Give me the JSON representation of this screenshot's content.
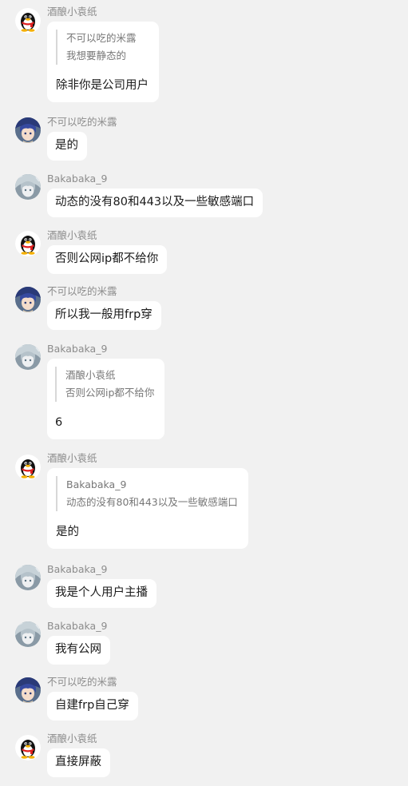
{
  "messages": [
    {
      "sender": "酒酿小袁纸",
      "avatar": "qq-penguin-icon",
      "quote": {
        "sender": "不可以吃的米露",
        "text": "我想要静态的"
      },
      "text": "除非你是公司用户"
    },
    {
      "sender": "不可以吃的米露",
      "avatar": "blue-hair-avatar-icon",
      "text": "是的"
    },
    {
      "sender": "Bakabaka_9",
      "avatar": "silver-hair-avatar-icon",
      "text": "动态的没有80和443以及一些敏感端口"
    },
    {
      "sender": "酒酿小袁纸",
      "avatar": "qq-penguin-icon",
      "text": "否则公网ip都不给你"
    },
    {
      "sender": "不可以吃的米露",
      "avatar": "blue-hair-avatar-icon",
      "text": "所以我一般用frp穿"
    },
    {
      "sender": "Bakabaka_9",
      "avatar": "silver-hair-avatar-icon",
      "quote": {
        "sender": "酒酿小袁纸",
        "text": "否则公网ip都不给你"
      },
      "text": "6"
    },
    {
      "sender": "酒酿小袁纸",
      "avatar": "qq-penguin-icon",
      "quote": {
        "sender": "Bakabaka_9",
        "text": "动态的没有80和443以及一些敏感端口"
      },
      "text": "是的"
    },
    {
      "sender": "Bakabaka_9",
      "avatar": "silver-hair-avatar-icon",
      "text": "我是个人用户主播"
    },
    {
      "sender": "Bakabaka_9",
      "avatar": "silver-hair-avatar-icon",
      "text": "我有公网"
    },
    {
      "sender": "不可以吃的米露",
      "avatar": "blue-hair-avatar-icon",
      "text": "自建frp自己穿"
    },
    {
      "sender": "酒酿小袁纸",
      "avatar": "qq-penguin-icon",
      "text": "直接屏蔽"
    }
  ],
  "colors": {
    "background": "#f1f1f1",
    "bubble": "#ffffff",
    "sender_name": "#8c8c8c",
    "message_text": "#1a1a1a",
    "quote_text": "#777777",
    "quote_bar": "#d8d8d8"
  }
}
